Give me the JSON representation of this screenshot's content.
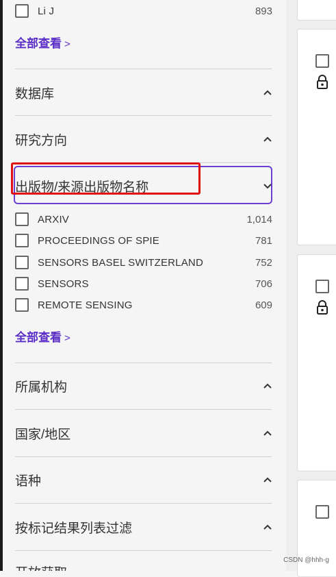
{
  "author_top": {
    "label": "Li J",
    "count": "893"
  },
  "view_all_1": "全部查看",
  "view_all_arrow": ">",
  "sections_top": [
    {
      "title": "数据库"
    },
    {
      "title": "研究方向"
    }
  ],
  "publication_section": {
    "title": "出版物/来源出版物名称",
    "items": [
      {
        "label": "ARXIV",
        "count": "1,014"
      },
      {
        "label": "PROCEEDINGS OF SPIE",
        "count": "781"
      },
      {
        "label": "SENSORS BASEL SWITZERLAND",
        "count": "752"
      },
      {
        "label": "SENSORS",
        "count": "706"
      },
      {
        "label": "REMOTE SENSING",
        "count": "609"
      }
    ]
  },
  "view_all_2": "全部查看",
  "sections_bottom": [
    {
      "title": "所属机构"
    },
    {
      "title": "国家/地区"
    },
    {
      "title": "语种"
    },
    {
      "title": "按标记结果列表过滤"
    },
    {
      "title": "开放获取"
    }
  ],
  "watermark": "CSDN @hhh-g",
  "colors": {
    "accent": "#5b2ec7",
    "highlight_red": "#e01010",
    "outline_purple": "#6b3fd2"
  }
}
